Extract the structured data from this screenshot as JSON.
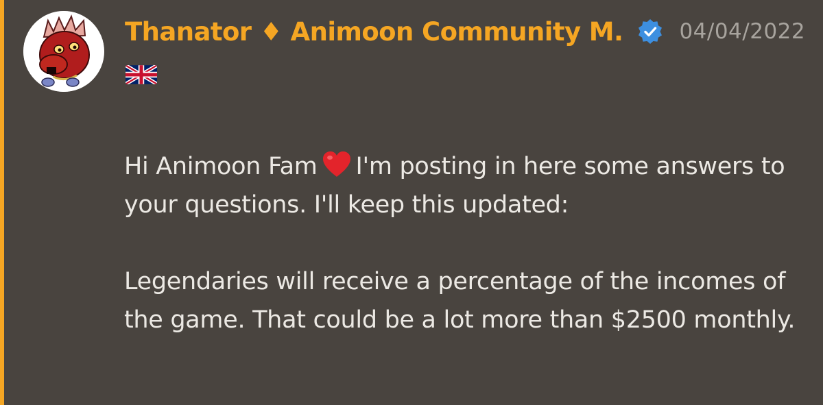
{
  "message": {
    "author": "Thanator ♦ Animoon Community M.",
    "author_color": "#f5a623",
    "verified_icon": "verified-badge-icon",
    "timestamp": "04/04/2022",
    "flag_icon": "uk-flag-icon",
    "paragraph1_before_heart": "Hi Animoon Fam",
    "heart_icon": "red-heart-emoji",
    "paragraph1_after_heart": "I'm posting in here some answers to your questions. I'll keep this updated:",
    "paragraph2": "Legendaries will receive a percentage of the incomes of the game. That could be a lot more than $2500 monthly."
  },
  "colors": {
    "background": "#49443f",
    "accent": "#f5a623",
    "text": "#ece9e4",
    "timestamp": "#a8a49e",
    "verified": "#3d8fe0"
  }
}
